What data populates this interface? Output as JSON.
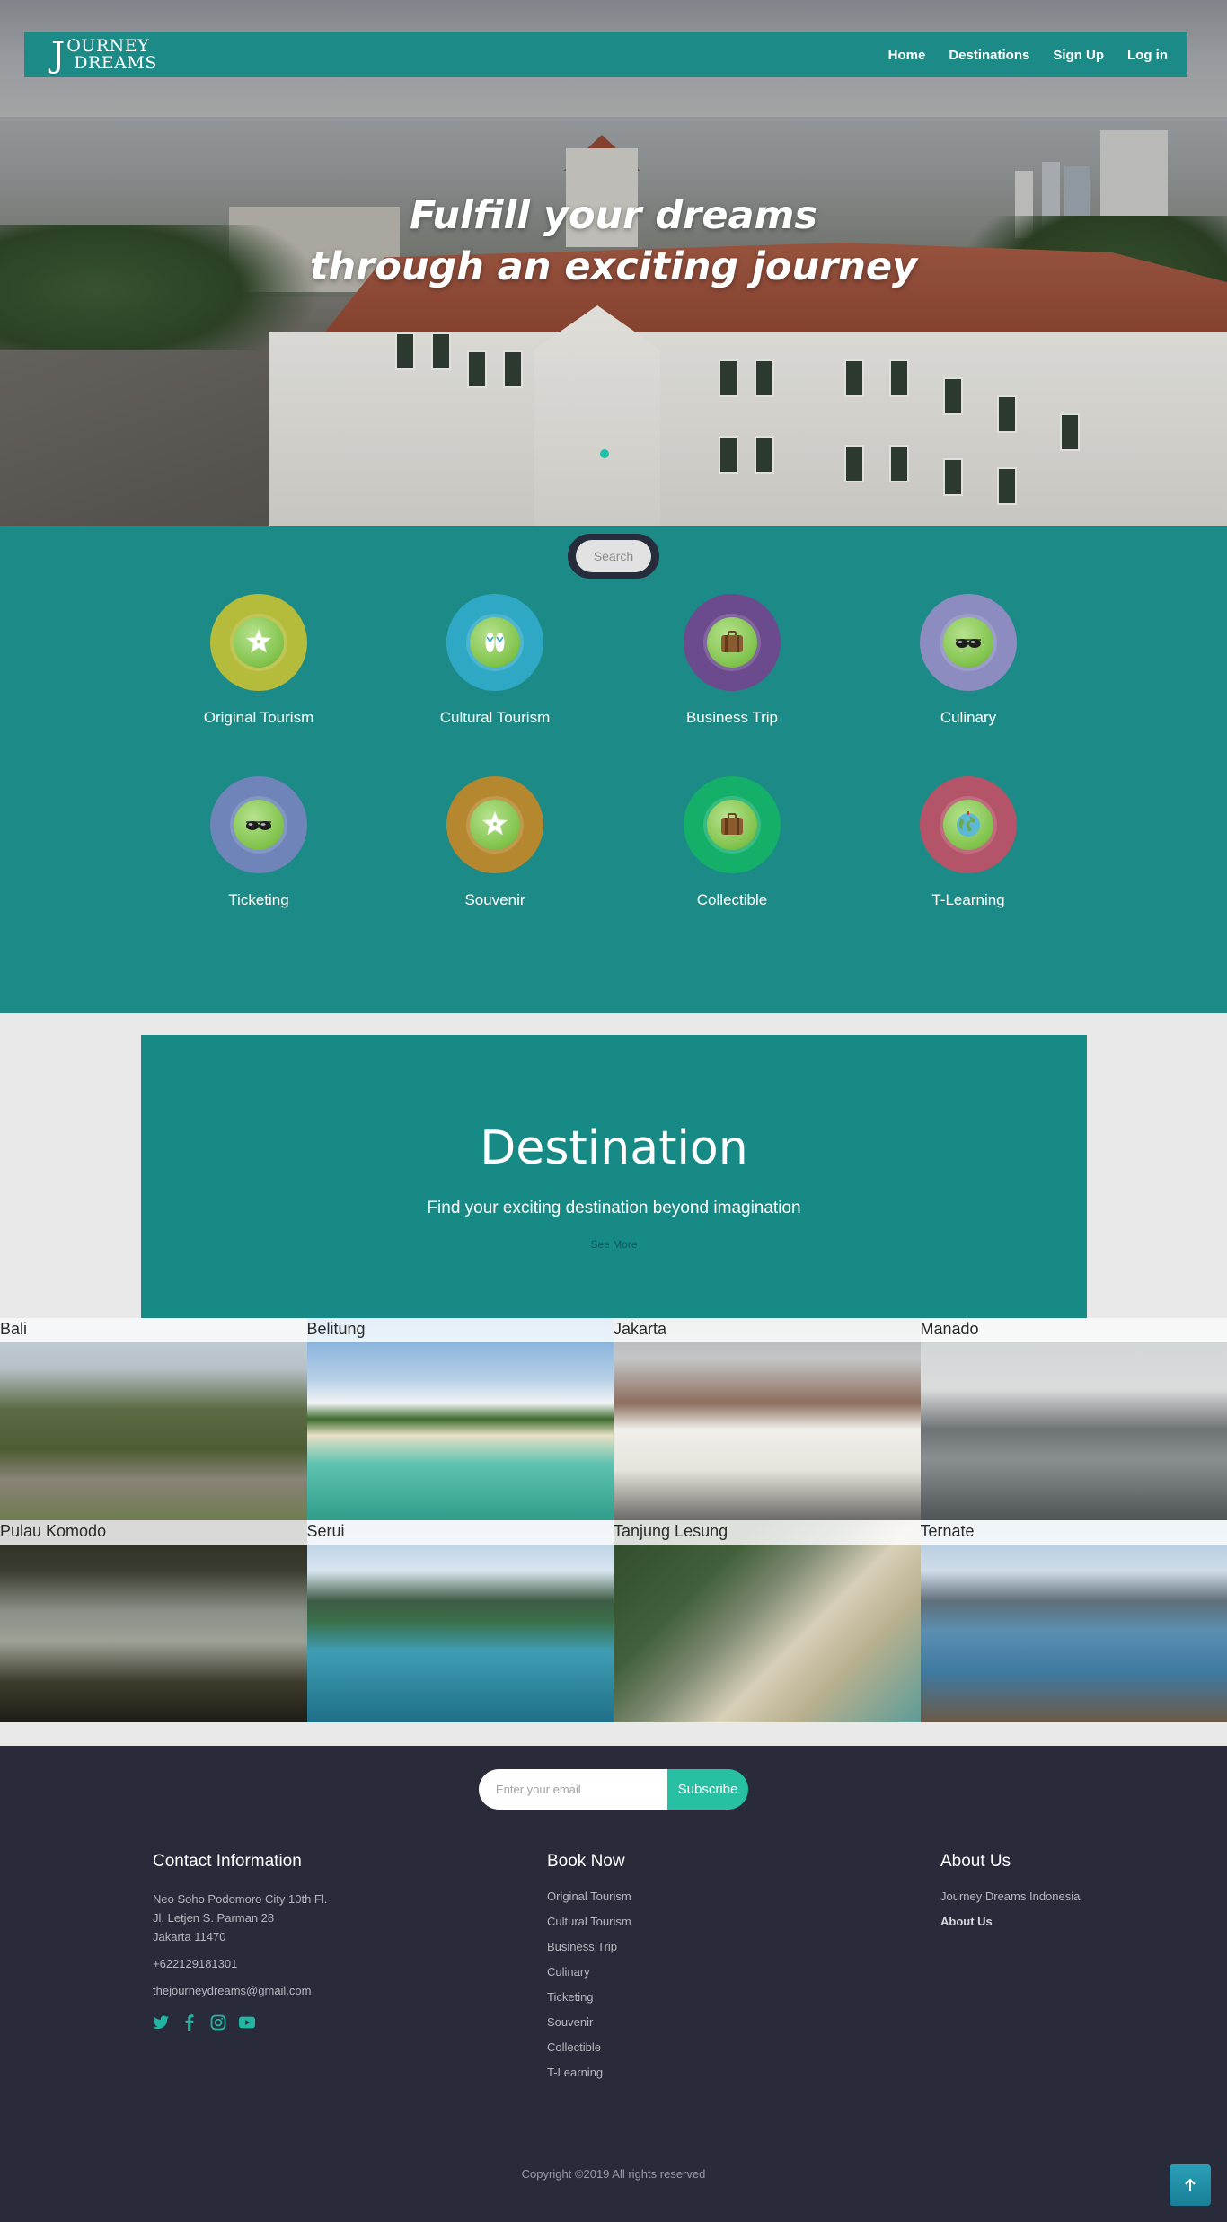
{
  "nav": {
    "logo_big": "J",
    "logo_line1": "OURNEY",
    "logo_line2": "DREAMS",
    "links": [
      "Home",
      "Destinations",
      "Sign Up",
      "Log in"
    ]
  },
  "hero": {
    "title_line1": "Fulfill your dreams",
    "title_line2": "through an exciting journey"
  },
  "search": {
    "label": "Search"
  },
  "categories": [
    {
      "label": "Original Tourism",
      "color": "#b5bb3a",
      "icon": "starfish-icon"
    },
    {
      "label": "Cultural Tourism",
      "color": "#2fa8c6",
      "icon": "sandals-icon"
    },
    {
      "label": "Business Trip",
      "color": "#6c4a8e",
      "icon": "suitcase-icon"
    },
    {
      "label": "Culinary",
      "color": "#8c8cc0",
      "icon": "sunglasses-icon"
    },
    {
      "label": "Ticketing",
      "color": "#6f84b8",
      "icon": "sunglasses-icon"
    },
    {
      "label": "Souvenir",
      "color": "#b5872f",
      "icon": "starfish-icon"
    },
    {
      "label": "Collectible",
      "color": "#14b06a",
      "icon": "suitcase-icon"
    },
    {
      "label": "T-Learning",
      "color": "#b45468",
      "icon": "globe-icon"
    }
  ],
  "destination": {
    "title": "Destination",
    "subtitle": "Find your exciting destination beyond imagination",
    "see_more": "See More",
    "places": [
      "Bali",
      "Belitung",
      "Jakarta",
      "Manado",
      "Pulau Komodo",
      "Serui",
      "Tanjung Lesung",
      "Ternate"
    ]
  },
  "footer": {
    "email_placeholder": "Enter your email",
    "subscribe": "Subscribe",
    "contact": {
      "title": "Contact Information",
      "address1": "Neo Soho Podomoro City 10th Fl.",
      "address2": "Jl. Letjen S. Parman 28",
      "address3": "Jakarta 11470",
      "phone": "+622129181301",
      "email": "thejourneydreams@gmail.com"
    },
    "book": {
      "title": "Book Now",
      "items": [
        "Original Tourism",
        "Cultural Tourism",
        "Business Trip",
        "Culinary",
        "Ticketing",
        "Souvenir",
        "Collectible",
        "T-Learning"
      ]
    },
    "about": {
      "title": "About Us",
      "items": [
        "Journey Dreams Indonesia",
        "About Us"
      ]
    },
    "copyright": "Copyright ©2019 All rights reserved"
  }
}
